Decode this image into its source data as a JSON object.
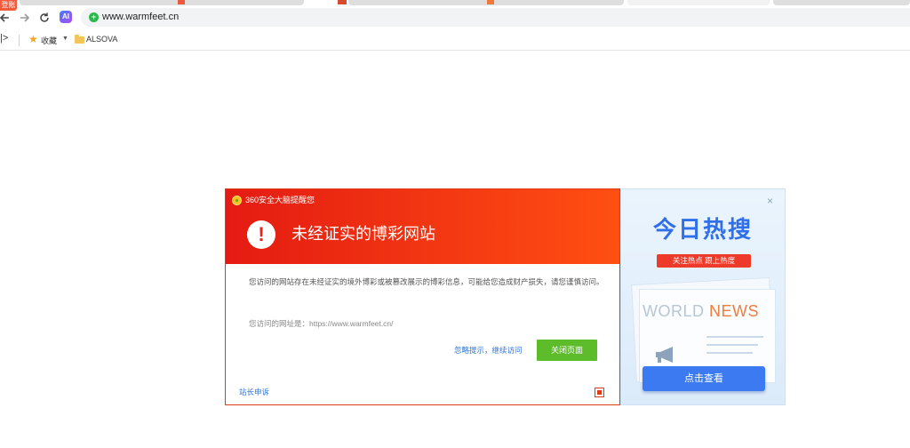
{
  "tabs": {
    "account_badge": "登账号"
  },
  "navbar": {
    "back_icon": "back-arrow-icon",
    "forward_icon": "forward-arrow-icon",
    "reload_icon": "reload-icon",
    "ai_label": "AI",
    "url": "www.warmfeet.cn"
  },
  "bookmarks": {
    "sidebar_toggle": "|>",
    "favorites_label": "收藏",
    "folder_label": "ALSOVA"
  },
  "dialog": {
    "brand": "360安全大脑提醒您",
    "title": "未经证实的博彩网站",
    "body": "您访问的网站存在未经证实的境外博彩或被篡改展示的博彩信息，可能给您造成财产损失，请您谨慎访问。",
    "url_text": "您访问的网址是：https://www.warmfeet.cn/",
    "ignore_link": "忽略提示，继续访问",
    "close_button": "关闭页面",
    "appeal_link": "站长申诉",
    "colors": {
      "header_start": "#e41b12",
      "header_end": "#ff4f12",
      "button": "#5dbc2a",
      "link": "#2f74d6"
    }
  },
  "ad": {
    "close": "×",
    "title": "今日热搜",
    "ribbon": "关注热点 跟上热度",
    "news_word1": "WORLD",
    "news_word2": "NEWS",
    "cta": "点击查看",
    "colors": {
      "title": "#2f6fea",
      "ribbon": "#ee3a2a",
      "cta": "#3b7af0"
    }
  }
}
